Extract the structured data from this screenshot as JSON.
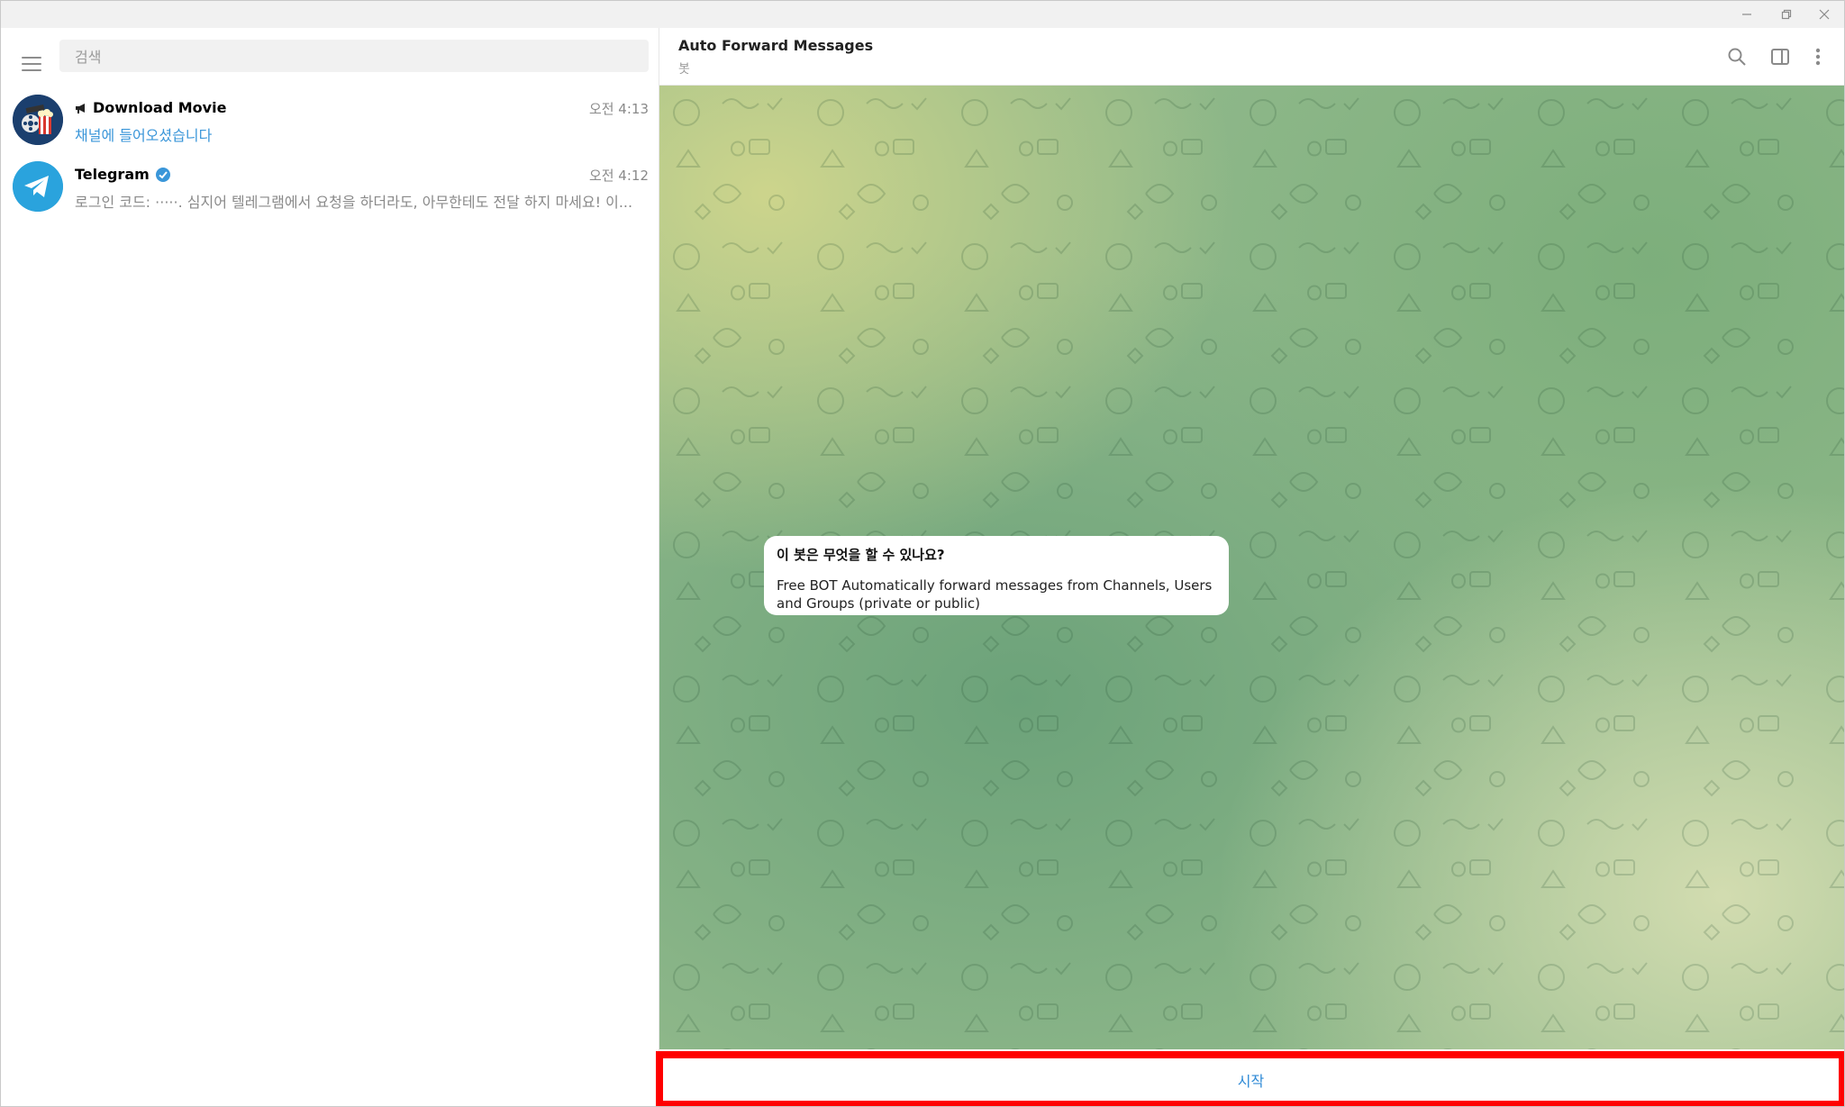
{
  "window": {
    "minimize_label": "—",
    "maximize_label": "❐",
    "close_label": "✕"
  },
  "sidebar": {
    "search_placeholder": "검색",
    "chats": [
      {
        "name": "Download Movie",
        "time": "오전 4:13",
        "preview": "채널에 들어오셨습니다",
        "is_channel": true
      },
      {
        "name": "Telegram",
        "time": "오전 4:12",
        "preview": "로그인 코드: ·····. 심지어 텔레그램에서 요청을 하더라도, 아무한테도 전달 하지 마세요!  이...",
        "verified": true
      }
    ]
  },
  "chat": {
    "title": "Auto Forward Messages",
    "subtitle": "봇",
    "bot_info": {
      "heading": "이 봇은 무엇을 할 수 있나요?",
      "description": "Free BOT Automatically forward messages from Channels, Users and Groups (private or public)"
    },
    "start_button_label": "시작"
  },
  "colors": {
    "accent": "#2e8ad6",
    "highlight_border": "#ff0000",
    "verified": "#3a96d9"
  }
}
